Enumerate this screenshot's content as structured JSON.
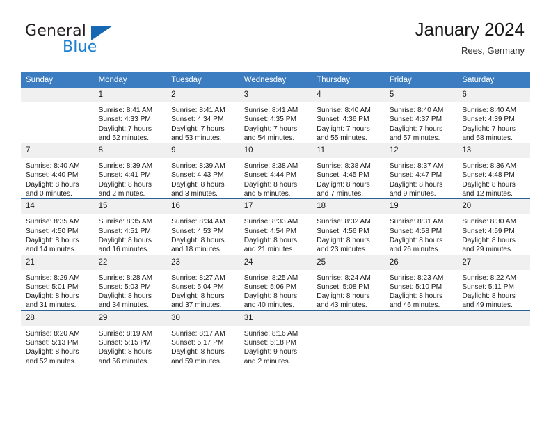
{
  "brand": {
    "name_part1": "General",
    "name_part2": "Blue"
  },
  "header": {
    "title": "January 2024",
    "subtitle": "Rees, Germany"
  },
  "colors": {
    "header_blue": "#3b7dc0",
    "row_divider_blue": "#2a6099",
    "daynum_band": "#f0f0f0",
    "logo_blue": "#1c7fd1"
  },
  "weekdays": [
    "Sunday",
    "Monday",
    "Tuesday",
    "Wednesday",
    "Thursday",
    "Friday",
    "Saturday"
  ],
  "weeks": [
    [
      {
        "day": "",
        "sunrise": "",
        "sunset": "",
        "daylight_line1": "",
        "daylight_line2": ""
      },
      {
        "day": "1",
        "sunrise": "Sunrise: 8:41 AM",
        "sunset": "Sunset: 4:33 PM",
        "daylight_line1": "Daylight: 7 hours",
        "daylight_line2": "and 52 minutes."
      },
      {
        "day": "2",
        "sunrise": "Sunrise: 8:41 AM",
        "sunset": "Sunset: 4:34 PM",
        "daylight_line1": "Daylight: 7 hours",
        "daylight_line2": "and 53 minutes."
      },
      {
        "day": "3",
        "sunrise": "Sunrise: 8:41 AM",
        "sunset": "Sunset: 4:35 PM",
        "daylight_line1": "Daylight: 7 hours",
        "daylight_line2": "and 54 minutes."
      },
      {
        "day": "4",
        "sunrise": "Sunrise: 8:40 AM",
        "sunset": "Sunset: 4:36 PM",
        "daylight_line1": "Daylight: 7 hours",
        "daylight_line2": "and 55 minutes."
      },
      {
        "day": "5",
        "sunrise": "Sunrise: 8:40 AM",
        "sunset": "Sunset: 4:37 PM",
        "daylight_line1": "Daylight: 7 hours",
        "daylight_line2": "and 57 minutes."
      },
      {
        "day": "6",
        "sunrise": "Sunrise: 8:40 AM",
        "sunset": "Sunset: 4:39 PM",
        "daylight_line1": "Daylight: 7 hours",
        "daylight_line2": "and 58 minutes."
      }
    ],
    [
      {
        "day": "7",
        "sunrise": "Sunrise: 8:40 AM",
        "sunset": "Sunset: 4:40 PM",
        "daylight_line1": "Daylight: 8 hours",
        "daylight_line2": "and 0 minutes."
      },
      {
        "day": "8",
        "sunrise": "Sunrise: 8:39 AM",
        "sunset": "Sunset: 4:41 PM",
        "daylight_line1": "Daylight: 8 hours",
        "daylight_line2": "and 2 minutes."
      },
      {
        "day": "9",
        "sunrise": "Sunrise: 8:39 AM",
        "sunset": "Sunset: 4:43 PM",
        "daylight_line1": "Daylight: 8 hours",
        "daylight_line2": "and 3 minutes."
      },
      {
        "day": "10",
        "sunrise": "Sunrise: 8:38 AM",
        "sunset": "Sunset: 4:44 PM",
        "daylight_line1": "Daylight: 8 hours",
        "daylight_line2": "and 5 minutes."
      },
      {
        "day": "11",
        "sunrise": "Sunrise: 8:38 AM",
        "sunset": "Sunset: 4:45 PM",
        "daylight_line1": "Daylight: 8 hours",
        "daylight_line2": "and 7 minutes."
      },
      {
        "day": "12",
        "sunrise": "Sunrise: 8:37 AM",
        "sunset": "Sunset: 4:47 PM",
        "daylight_line1": "Daylight: 8 hours",
        "daylight_line2": "and 9 minutes."
      },
      {
        "day": "13",
        "sunrise": "Sunrise: 8:36 AM",
        "sunset": "Sunset: 4:48 PM",
        "daylight_line1": "Daylight: 8 hours",
        "daylight_line2": "and 12 minutes."
      }
    ],
    [
      {
        "day": "14",
        "sunrise": "Sunrise: 8:35 AM",
        "sunset": "Sunset: 4:50 PM",
        "daylight_line1": "Daylight: 8 hours",
        "daylight_line2": "and 14 minutes."
      },
      {
        "day": "15",
        "sunrise": "Sunrise: 8:35 AM",
        "sunset": "Sunset: 4:51 PM",
        "daylight_line1": "Daylight: 8 hours",
        "daylight_line2": "and 16 minutes."
      },
      {
        "day": "16",
        "sunrise": "Sunrise: 8:34 AM",
        "sunset": "Sunset: 4:53 PM",
        "daylight_line1": "Daylight: 8 hours",
        "daylight_line2": "and 18 minutes."
      },
      {
        "day": "17",
        "sunrise": "Sunrise: 8:33 AM",
        "sunset": "Sunset: 4:54 PM",
        "daylight_line1": "Daylight: 8 hours",
        "daylight_line2": "and 21 minutes."
      },
      {
        "day": "18",
        "sunrise": "Sunrise: 8:32 AM",
        "sunset": "Sunset: 4:56 PM",
        "daylight_line1": "Daylight: 8 hours",
        "daylight_line2": "and 23 minutes."
      },
      {
        "day": "19",
        "sunrise": "Sunrise: 8:31 AM",
        "sunset": "Sunset: 4:58 PM",
        "daylight_line1": "Daylight: 8 hours",
        "daylight_line2": "and 26 minutes."
      },
      {
        "day": "20",
        "sunrise": "Sunrise: 8:30 AM",
        "sunset": "Sunset: 4:59 PM",
        "daylight_line1": "Daylight: 8 hours",
        "daylight_line2": "and 29 minutes."
      }
    ],
    [
      {
        "day": "21",
        "sunrise": "Sunrise: 8:29 AM",
        "sunset": "Sunset: 5:01 PM",
        "daylight_line1": "Daylight: 8 hours",
        "daylight_line2": "and 31 minutes."
      },
      {
        "day": "22",
        "sunrise": "Sunrise: 8:28 AM",
        "sunset": "Sunset: 5:03 PM",
        "daylight_line1": "Daylight: 8 hours",
        "daylight_line2": "and 34 minutes."
      },
      {
        "day": "23",
        "sunrise": "Sunrise: 8:27 AM",
        "sunset": "Sunset: 5:04 PM",
        "daylight_line1": "Daylight: 8 hours",
        "daylight_line2": "and 37 minutes."
      },
      {
        "day": "24",
        "sunrise": "Sunrise: 8:25 AM",
        "sunset": "Sunset: 5:06 PM",
        "daylight_line1": "Daylight: 8 hours",
        "daylight_line2": "and 40 minutes."
      },
      {
        "day": "25",
        "sunrise": "Sunrise: 8:24 AM",
        "sunset": "Sunset: 5:08 PM",
        "daylight_line1": "Daylight: 8 hours",
        "daylight_line2": "and 43 minutes."
      },
      {
        "day": "26",
        "sunrise": "Sunrise: 8:23 AM",
        "sunset": "Sunset: 5:10 PM",
        "daylight_line1": "Daylight: 8 hours",
        "daylight_line2": "and 46 minutes."
      },
      {
        "day": "27",
        "sunrise": "Sunrise: 8:22 AM",
        "sunset": "Sunset: 5:11 PM",
        "daylight_line1": "Daylight: 8 hours",
        "daylight_line2": "and 49 minutes."
      }
    ],
    [
      {
        "day": "28",
        "sunrise": "Sunrise: 8:20 AM",
        "sunset": "Sunset: 5:13 PM",
        "daylight_line1": "Daylight: 8 hours",
        "daylight_line2": "and 52 minutes."
      },
      {
        "day": "29",
        "sunrise": "Sunrise: 8:19 AM",
        "sunset": "Sunset: 5:15 PM",
        "daylight_line1": "Daylight: 8 hours",
        "daylight_line2": "and 56 minutes."
      },
      {
        "day": "30",
        "sunrise": "Sunrise: 8:17 AM",
        "sunset": "Sunset: 5:17 PM",
        "daylight_line1": "Daylight: 8 hours",
        "daylight_line2": "and 59 minutes."
      },
      {
        "day": "31",
        "sunrise": "Sunrise: 8:16 AM",
        "sunset": "Sunset: 5:18 PM",
        "daylight_line1": "Daylight: 9 hours",
        "daylight_line2": "and 2 minutes."
      },
      {
        "day": "",
        "sunrise": "",
        "sunset": "",
        "daylight_line1": "",
        "daylight_line2": ""
      },
      {
        "day": "",
        "sunrise": "",
        "sunset": "",
        "daylight_line1": "",
        "daylight_line2": ""
      },
      {
        "day": "",
        "sunrise": "",
        "sunset": "",
        "daylight_line1": "",
        "daylight_line2": ""
      }
    ]
  ]
}
